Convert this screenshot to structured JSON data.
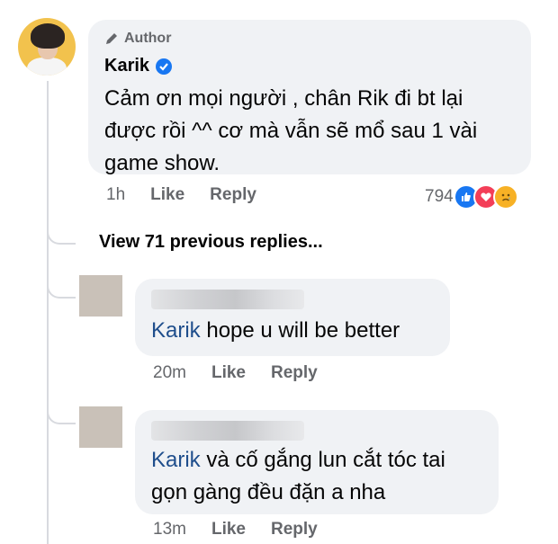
{
  "main_comment": {
    "author_badge": "Author",
    "author_name": "Karik",
    "text": "Cảm ơn mọi người , chân Rik đi bt lại được rồi ^^ cơ mà vẫn sẽ mổ sau 1 vài game show.",
    "time": "1h",
    "like_label": "Like",
    "reply_label": "Reply",
    "reaction_count": "794",
    "reactions": [
      "like-icon",
      "love-icon",
      "sad-icon"
    ]
  },
  "view_previous": "View 71 previous replies...",
  "replies": [
    {
      "mention": "Karik",
      "text": " hope u will be better",
      "time": "20m",
      "like_label": "Like",
      "reply_label": "Reply"
    },
    {
      "mention": "Karik",
      "text_line1": " và cố gắng lun cắt tóc tai",
      "text_line2": "gọn gàng đều đặn a nha",
      "time": "13m",
      "like_label": "Like",
      "reply_label": "Reply"
    }
  ],
  "colors": {
    "bubble": "#f0f2f5",
    "meta_text": "#65676b",
    "mention": "#1f4e8c",
    "like_blue": "#1877f2",
    "love_red": "#f33e58",
    "sad_yellow": "#f7b125"
  }
}
